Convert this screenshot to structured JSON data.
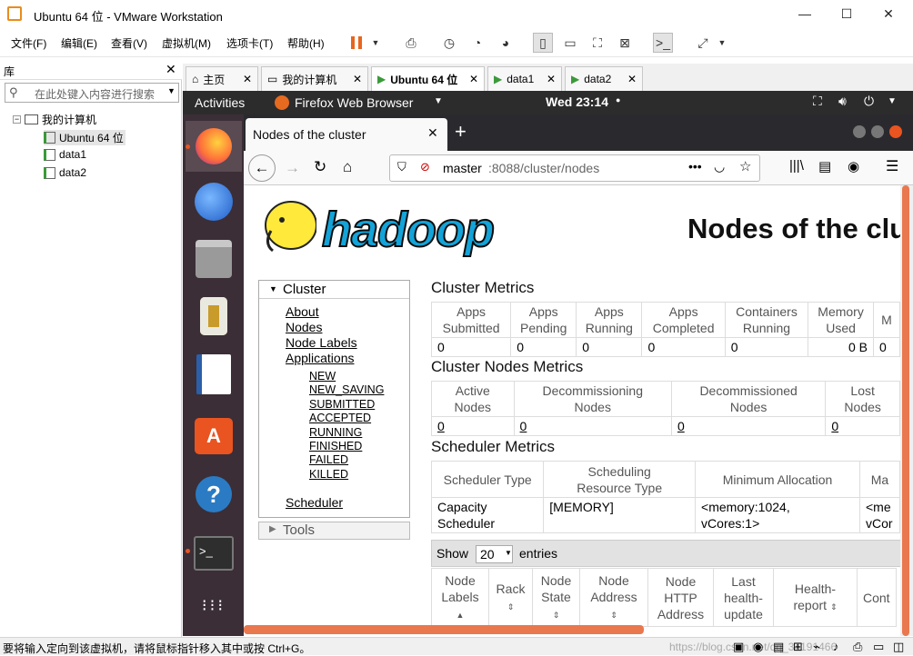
{
  "window": {
    "title": "Ubuntu 64 位 - VMware Workstation",
    "min_icon": "minimize-icon",
    "max_icon": "maximize-icon",
    "close_icon": "close-icon"
  },
  "menu": [
    "文件(F)",
    "编辑(E)",
    "查看(V)",
    "虚拟机(M)",
    "选项卡(T)",
    "帮助(H)"
  ],
  "library": {
    "title": "库",
    "search_placeholder": "在此处键入内容进行搜索",
    "tree": {
      "root": "我的计算机",
      "children": [
        "Ubuntu 64 位",
        "data1",
        "data2"
      ]
    }
  },
  "vm_tabs": [
    "主页",
    "我的计算机",
    "Ubuntu 64 位",
    "data1",
    "data2"
  ],
  "ubuntu": {
    "activities": "Activities",
    "app": "Firefox Web Browser",
    "clock": "Wed 23:14"
  },
  "firefox": {
    "tab_title": "Nodes of the cluster",
    "url_host": "master",
    "url_rest": ":8088/cluster/nodes"
  },
  "page": {
    "logo_text": "hadoop",
    "heading": "Nodes of the clu",
    "nav": {
      "cluster": "Cluster",
      "about": "About",
      "nodes": "Nodes",
      "node_labels": "Node Labels",
      "applications": "Applications",
      "states": [
        "NEW",
        "NEW_SAVING",
        "SUBMITTED",
        "ACCEPTED",
        "RUNNING",
        "FINISHED",
        "FAILED",
        "KILLED"
      ],
      "scheduler": "Scheduler",
      "tools": "Tools"
    },
    "cluster_metrics": {
      "title": "Cluster Metrics",
      "headers": [
        [
          "Apps",
          "Submitted"
        ],
        [
          "Apps",
          "Pending"
        ],
        [
          "Apps",
          "Running"
        ],
        [
          "Apps",
          "Completed"
        ],
        [
          "Containers",
          "Running"
        ],
        [
          "Memory",
          "Used"
        ],
        [
          "M",
          ""
        ]
      ],
      "values": [
        "0",
        "0",
        "0",
        "0",
        "0",
        "0 B",
        "0"
      ]
    },
    "node_metrics": {
      "title": "Cluster Nodes Metrics",
      "headers": [
        [
          "Active",
          "Nodes"
        ],
        [
          "Decommissioning",
          "Nodes"
        ],
        [
          "Decommissioned",
          "Nodes"
        ],
        [
          "Lost",
          "Nodes"
        ]
      ],
      "values": [
        "0",
        "0",
        "0",
        "0"
      ]
    },
    "scheduler_metrics": {
      "title": "Scheduler Metrics",
      "headers": [
        "Scheduler Type",
        [
          "Scheduling",
          "Resource Type"
        ],
        "Minimum Allocation",
        "Ma"
      ],
      "row": [
        [
          "Capacity",
          "Scheduler"
        ],
        "[MEMORY]",
        [
          "<memory:1024,",
          "vCores:1>"
        ],
        [
          "<me",
          "vCor"
        ]
      ]
    },
    "entries": {
      "show": "Show",
      "value": "20",
      "suffix": "entries"
    },
    "nodes_table": {
      "headers": [
        [
          "Node",
          "Labels"
        ],
        [
          "Rack",
          ""
        ],
        [
          "Node",
          "State"
        ],
        [
          "Node",
          "Address"
        ],
        [
          "Node",
          "HTTP",
          "Address"
        ],
        [
          "Last",
          "health-",
          "update"
        ],
        [
          "Health-",
          "report"
        ],
        [
          "Cont",
          ""
        ]
      ]
    }
  },
  "statusbar": {
    "text": "要将输入定向到该虚拟机，请将鼠标指针移入其中或按 Ctrl+G。",
    "watermark": "https://blog.csdn.net/qq_34191466"
  }
}
